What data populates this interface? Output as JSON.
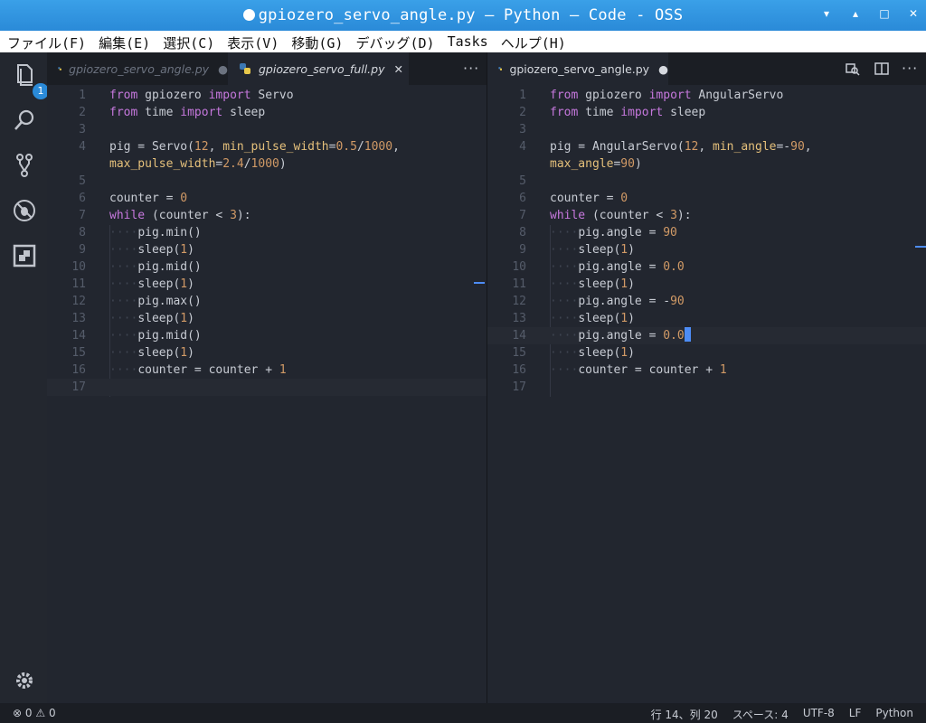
{
  "window": {
    "title": "gpiozero_servo_angle.py — Python — Code - OSS"
  },
  "menu": [
    "ファイル(F)",
    "編集(E)",
    "選択(C)",
    "表示(V)",
    "移動(G)",
    "デバッグ(D)",
    "Tasks",
    "ヘルプ(H)"
  ],
  "activity_bar": {
    "explorer_badge": "1"
  },
  "left_editor": {
    "tabs": [
      {
        "label": "gpiozero_servo_angle.py",
        "mark": "●"
      },
      {
        "label": "gpiozero_servo_full.py",
        "mark": "✕"
      }
    ],
    "lines": [
      {
        "n": "1",
        "html": "<span class=\"kw\">from</span> gpiozero <span class=\"kw\">import</span> Servo"
      },
      {
        "n": "2",
        "html": "<span class=\"kw\">from</span> time <span class=\"kw\">import</span> sleep"
      },
      {
        "n": "3",
        "html": ""
      },
      {
        "n": "4",
        "html": "pig = Servo(<span class=\"num\">12</span>, <span class=\"arg\">min_pulse_width</span>=<span class=\"num\">0.5</span>/<span class=\"num\">1000</span>,"
      },
      {
        "n": "",
        "html": "<span class=\"arg\">max_pulse_width</span>=<span class=\"num\">2.4</span>/<span class=\"num\">1000</span>)"
      },
      {
        "n": "5",
        "html": ""
      },
      {
        "n": "6",
        "html": "counter = <span class=\"num\">0</span>"
      },
      {
        "n": "7",
        "html": "<span class=\"kw\">while</span> (counter &lt; <span class=\"num\">3</span>):"
      },
      {
        "n": "8",
        "html": "<span class=\"dots\">····</span>pig.min()"
      },
      {
        "n": "9",
        "html": "<span class=\"dots\">····</span>sleep(<span class=\"num\">1</span>)"
      },
      {
        "n": "10",
        "html": "<span class=\"dots\">····</span>pig.mid()"
      },
      {
        "n": "11",
        "html": "<span class=\"dots\">····</span>sleep(<span class=\"num\">1</span>)"
      },
      {
        "n": "12",
        "html": "<span class=\"dots\">····</span>pig.max()"
      },
      {
        "n": "13",
        "html": "<span class=\"dots\">····</span>sleep(<span class=\"num\">1</span>)"
      },
      {
        "n": "14",
        "html": "<span class=\"dots\">····</span>pig.mid()"
      },
      {
        "n": "15",
        "html": "<span class=\"dots\">····</span>sleep(<span class=\"num\">1</span>)"
      },
      {
        "n": "16",
        "html": "<span class=\"dots\">····</span>counter = counter + <span class=\"num\">1</span>"
      },
      {
        "n": "17",
        "html": ""
      }
    ]
  },
  "right_editor": {
    "tabs": [
      {
        "label": "gpiozero_servo_angle.py",
        "mark": "●"
      }
    ],
    "lines": [
      {
        "n": "1",
        "html": "<span class=\"kw\">from</span> gpiozero <span class=\"kw\">import</span> AngularServo"
      },
      {
        "n": "2",
        "html": "<span class=\"kw\">from</span> time <span class=\"kw\">import</span> sleep"
      },
      {
        "n": "3",
        "html": ""
      },
      {
        "n": "4",
        "html": "pig = AngularServo(<span class=\"num\">12</span>, <span class=\"arg\">min_angle</span>=-<span class=\"num\">90</span>,"
      },
      {
        "n": "",
        "html": "<span class=\"arg\">max_angle</span>=<span class=\"num\">90</span>)"
      },
      {
        "n": "5",
        "html": ""
      },
      {
        "n": "6",
        "html": "counter = <span class=\"num\">0</span>"
      },
      {
        "n": "7",
        "html": "<span class=\"kw\">while</span> (counter &lt; <span class=\"num\">3</span>):"
      },
      {
        "n": "8",
        "html": "<span class=\"dots\">····</span>pig.angle = <span class=\"num\">90</span>"
      },
      {
        "n": "9",
        "html": "<span class=\"dots\">····</span>sleep(<span class=\"num\">1</span>)"
      },
      {
        "n": "10",
        "html": "<span class=\"dots\">····</span>pig.angle = <span class=\"num\">0.0</span>"
      },
      {
        "n": "11",
        "html": "<span class=\"dots\">····</span>sleep(<span class=\"num\">1</span>)"
      },
      {
        "n": "12",
        "html": "<span class=\"dots\">····</span>pig.angle = -<span class=\"num\">90</span>"
      },
      {
        "n": "13",
        "html": "<span class=\"dots\">····</span>sleep(<span class=\"num\">1</span>)"
      },
      {
        "n": "14",
        "html": "<span class=\"dots\">····</span>pig.angle = <span class=\"num\">0.0</span><span class=\"cursor\"></span>"
      },
      {
        "n": "15",
        "html": "<span class=\"dots\">····</span>sleep(<span class=\"num\">1</span>)"
      },
      {
        "n": "16",
        "html": "<span class=\"dots\">····</span>counter = counter + <span class=\"num\">1</span>"
      },
      {
        "n": "17",
        "html": ""
      }
    ]
  },
  "status": {
    "errors": "0",
    "warnings": "0",
    "position": "行 14、列 20",
    "spaces": "スペース: 4",
    "encoding": "UTF-8",
    "eol": "LF",
    "language": "Python"
  },
  "colors": {
    "accent": "#2a8ad8",
    "keyword": "#c678dd",
    "number": "#d19a66",
    "param": "#e5c07b"
  }
}
